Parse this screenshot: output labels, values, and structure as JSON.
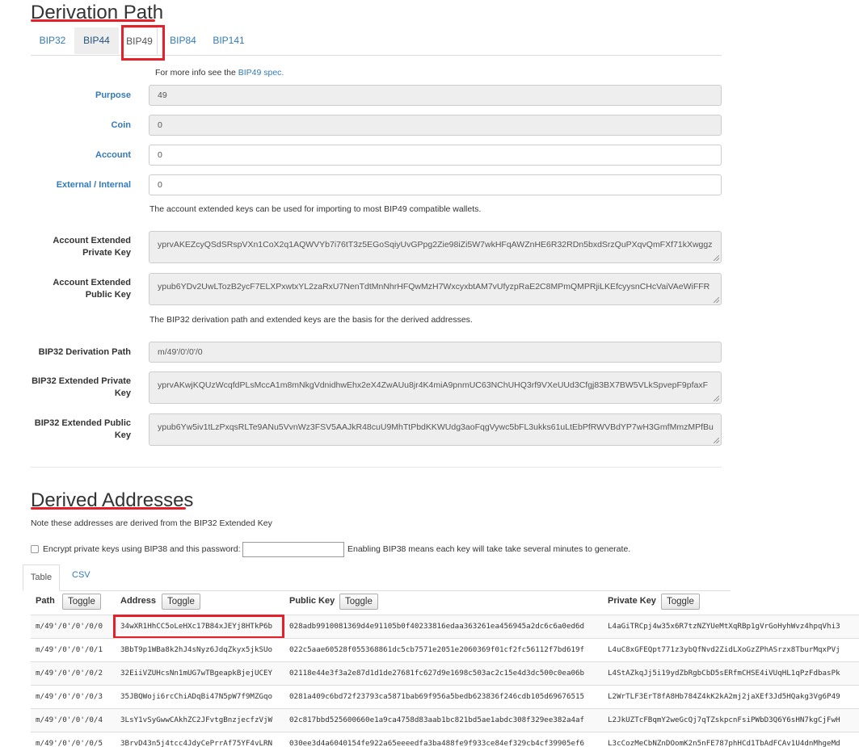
{
  "derivation": {
    "title": "Derivation Path",
    "tabs": [
      "BIP32",
      "BIP44",
      "BIP49",
      "BIP84",
      "BIP141"
    ],
    "active_tab": "BIP49",
    "info_prefix": "For more info see the ",
    "info_link": "BIP49 spec.",
    "purpose_label": "Purpose",
    "purpose_value": "49",
    "coin_label": "Coin",
    "coin_value": "0",
    "account_label": "Account",
    "account_value": "0",
    "external_label": "External / Internal",
    "external_value": "0",
    "account_keys_note": "The account extended keys can be used for importing to most BIP49 compatible wallets.",
    "acct_priv_label": "Account Extended Private Key",
    "acct_priv_value": "yprvAKEZcyQSdSRspVXn1CoX2q1AQWVYb7i76tT3z5EGoSqiyUvGPpg2Zie98iZi5W7wkHFqAWZnHE6R32RDn5bxdSrzQuPXqvQmFXf71kXwggz",
    "acct_pub_label": "Account Extended Public Key",
    "acct_pub_value": "ypub6YDv2UwLTozB2ycF7ELXPxwtxYL2zaRxU7NenTdtMnNhrHFQwMzH7WxcyxbtAM7vUfyzpRaE2C8MPmQMPRjiLKEfcyysnCHcVaiVAeWiFFR",
    "bip32_note": "The BIP32 derivation path and extended keys are the basis for the derived addresses.",
    "bip32_path_label": "BIP32 Derivation Path",
    "bip32_path_value": "m/49'/0'/0'/0",
    "bip32_priv_label": "BIP32 Extended Private Key",
    "bip32_priv_value": "yprvAKwjKQUzWcqfdPLsMccA1m8mNkgVdnidhwEhx2eX4ZwAUu8jr4K4miA9pnmUC63NChUHQ3rf9VXeUUd3Cfgj83BX7BW5VLkSpvepF9pfaxF",
    "bip32_pub_label": "BIP32 Extended Public Key",
    "bip32_pub_value": "ypub6Yw5iv1tLzPxqsRLTe9ANu5VvnWz3FSV5AAJkR48cuU9MhTtPbdKKWUdg3aoFqgVywc5bFL3ukks61uLtEbPfRWVBdYP7wH3GmfMmzMPfBu"
  },
  "derived": {
    "title": "Derived Addresses",
    "note": "Note these addresses are derived from the BIP32 Extended Key",
    "encrypt_label": "Encrypt private keys using BIP38 and this password:",
    "encrypt_note": "Enabling BIP38 means each key will take take several minutes to generate.",
    "tabs": [
      "Table",
      "CSV"
    ],
    "headers": {
      "path": "Path",
      "address": "Address",
      "pubkey": "Public Key",
      "privkey": "Private Key",
      "toggle": "Toggle"
    },
    "rows": [
      {
        "path": "m/49'/0'/0'/0/0",
        "address": "34wXR1HhCC5oLeHXc17B84xJEYj8HTkP6b",
        "pub": "028adb9910081369d4e91105b0f40233816edaa363261ea456945a2dc6c6a0ed6d",
        "priv": "L4aGiTRCpj4w35x6R7tzNZYUeMtXqRBp1gVrGoHyhWvz4hpqVhi3"
      },
      {
        "path": "m/49'/0'/0'/0/1",
        "address": "3BbT9p1WBa8k2hJ4sNyz6JdqZkyx5jkSUo",
        "pub": "022c5aae60528f055368861dc5cb7571e2051e2060369f01cf2fc56112f7bd619f",
        "priv": "L4uC8xGFEQpt771z3ybQfNvd2ZidLXoGzZPhASrzx8TburMqxPVj"
      },
      {
        "path": "m/49'/0'/0'/0/2",
        "address": "32EiiVZUHcsNn1mUG7wTBgeapkBjejUCEY",
        "pub": "02118e44e3f3a2e87d1d1de27681fc627d9e1698c503ac2c15e4d3dc500c0ea06b",
        "priv": "L4StAZkqJj5i19ydZbRgbCbD5sERfmCHSE4iVUqHL1qPzFdbasPk"
      },
      {
        "path": "m/49'/0'/0'/0/3",
        "address": "35JBQWoji6rcChiADqBi47N5pW7f9MZGqo",
        "pub": "0281a409c6bd72f23793ca5871bab69f956a5bedb623836f246cdb105d69676515",
        "priv": "L2WrTLF3ErT8fA8Hb784Z4kK2kA2mj2jaXEf3Jd5HQakg3Vg6P49"
      },
      {
        "path": "m/49'/0'/0'/0/4",
        "address": "3LsY1vSyGwwCAkhZC2JFvtgBnzjecfzVjW",
        "pub": "02c817bbd525600660e1a9ca4758d83aab1bc821bd5ae1abdc308f329ee382a4af",
        "priv": "L2JkUZTcFBqmY2weGcQj7qTZskpcnFsiPWbD3Q6Y6sHN7kgCjFwH"
      },
      {
        "path": "m/49'/0'/0'/0/5",
        "address": "3BrvD43n5j4tcc4JdyCePrrAf75YF4vLRN",
        "pub": "030ee3d4a6040154fe922a65eeeedfa3ba488fe9f933ce84ef329cb4cf39905ef6",
        "priv": "L3cCozMeCbNZnDOomK2n5nFE787phHCd1TbAdFCAv1U4dnMhgeMd"
      }
    ]
  }
}
